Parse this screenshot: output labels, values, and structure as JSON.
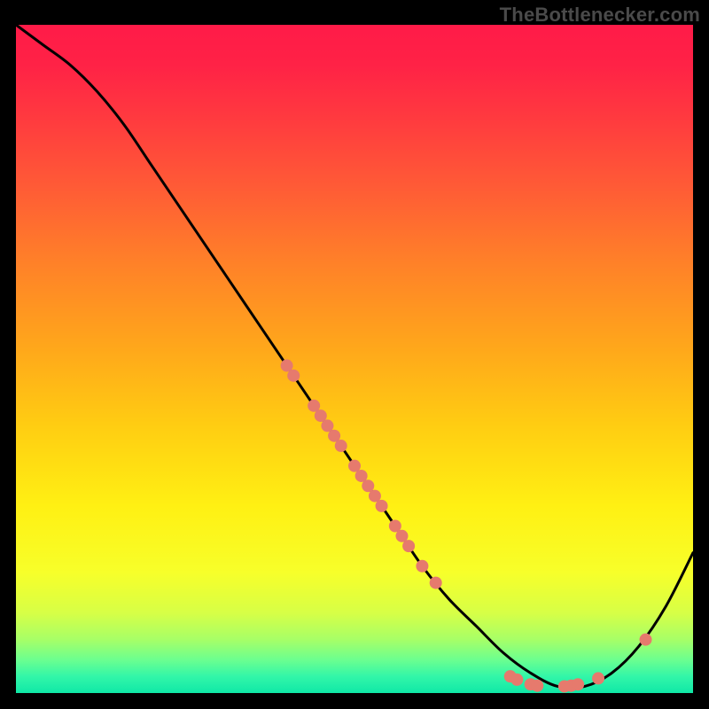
{
  "watermark": "TheBottlenecker.com",
  "chart_data": {
    "type": "line",
    "title": "",
    "xlabel": "",
    "ylabel": "",
    "xlim": [
      0,
      100
    ],
    "ylim": [
      0,
      100
    ],
    "curve": {
      "x": [
        0,
        4,
        8,
        12,
        16,
        20,
        24,
        28,
        32,
        36,
        40,
        44,
        48,
        52,
        56,
        60,
        64,
        68,
        72,
        76,
        80,
        84,
        88,
        92,
        96,
        100
      ],
      "y": [
        100,
        97,
        94,
        90,
        85,
        79,
        73,
        67,
        61,
        55,
        49,
        43,
        37,
        31,
        25,
        19,
        14,
        10,
        6,
        3,
        1,
        1,
        3,
        7,
        13,
        21
      ]
    },
    "markers": [
      {
        "x": 40,
        "y": 49
      },
      {
        "x": 41,
        "y": 47.5
      },
      {
        "x": 44,
        "y": 43
      },
      {
        "x": 45,
        "y": 41.5
      },
      {
        "x": 46,
        "y": 40
      },
      {
        "x": 47,
        "y": 38.5
      },
      {
        "x": 48,
        "y": 37
      },
      {
        "x": 50,
        "y": 34
      },
      {
        "x": 51,
        "y": 32.5
      },
      {
        "x": 52,
        "y": 31
      },
      {
        "x": 53,
        "y": 29.5
      },
      {
        "x": 54,
        "y": 28
      },
      {
        "x": 56,
        "y": 25
      },
      {
        "x": 57,
        "y": 23.5
      },
      {
        "x": 58,
        "y": 22
      },
      {
        "x": 60,
        "y": 19
      },
      {
        "x": 62,
        "y": 16.5
      },
      {
        "x": 73,
        "y": 2.5
      },
      {
        "x": 74,
        "y": 2
      },
      {
        "x": 76,
        "y": 1.3
      },
      {
        "x": 77,
        "y": 1.1
      },
      {
        "x": 81,
        "y": 1
      },
      {
        "x": 82,
        "y": 1.1
      },
      {
        "x": 83,
        "y": 1.3
      },
      {
        "x": 86,
        "y": 2.2
      },
      {
        "x": 93,
        "y": 8
      }
    ],
    "marker_color": "#e67a6d",
    "curve_color": "#000000",
    "gradient_stops": [
      {
        "offset": 0.0,
        "color": "#ff1b48"
      },
      {
        "offset": 0.06,
        "color": "#ff2246"
      },
      {
        "offset": 0.14,
        "color": "#ff3a3f"
      },
      {
        "offset": 0.24,
        "color": "#ff5a36"
      },
      {
        "offset": 0.36,
        "color": "#ff8228"
      },
      {
        "offset": 0.48,
        "color": "#ffa61b"
      },
      {
        "offset": 0.6,
        "color": "#ffcd12"
      },
      {
        "offset": 0.72,
        "color": "#fff013"
      },
      {
        "offset": 0.82,
        "color": "#f7ff2a"
      },
      {
        "offset": 0.88,
        "color": "#d7ff46"
      },
      {
        "offset": 0.92,
        "color": "#a7ff67"
      },
      {
        "offset": 0.95,
        "color": "#6cff8f"
      },
      {
        "offset": 0.975,
        "color": "#33f6a8"
      },
      {
        "offset": 1.0,
        "color": "#0fe8a7"
      }
    ]
  }
}
